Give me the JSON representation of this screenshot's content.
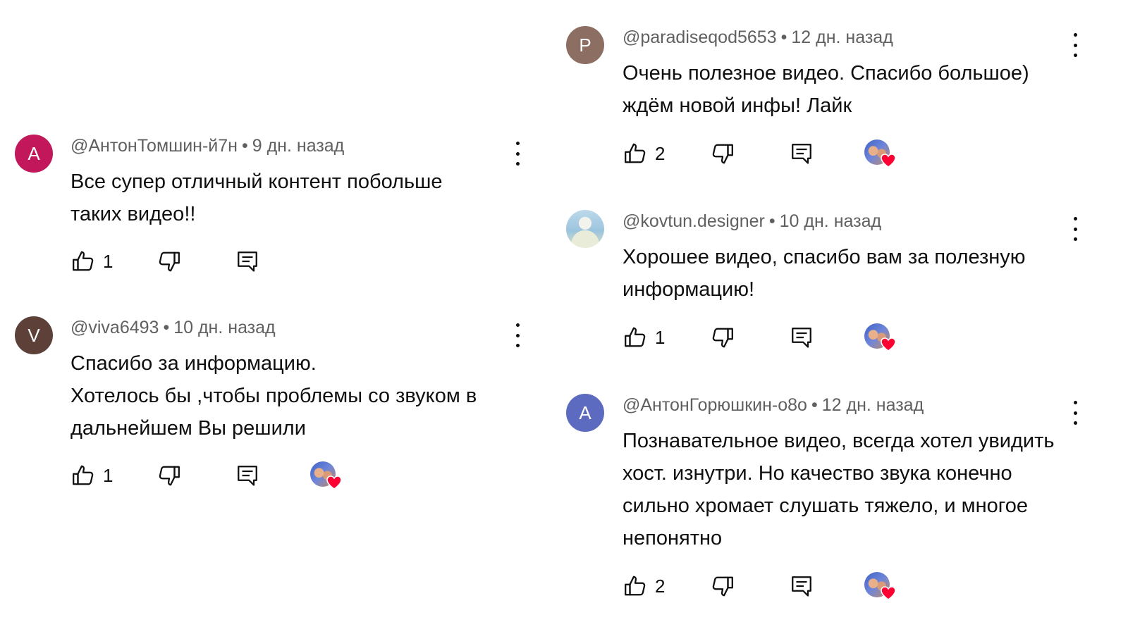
{
  "colors": {
    "avatar_A1": "#c2185b",
    "avatar_V": "#5d4037",
    "avatar_P": "#8d6e63",
    "avatar_A2": "#5c6bc0",
    "heart": "#ff0033"
  },
  "comments": [
    {
      "author": "@АнтонТомшин-й7н",
      "time": "9 дн. назад",
      "avatar_letter": "A",
      "text": "Все супер отличный контент побольше таких видео!!",
      "likes": "1",
      "creator_heart": false
    },
    {
      "author": "@viva6493",
      "time": "10 дн. назад",
      "avatar_letter": "V",
      "text_lines": [
        "Спасибо за информацию.",
        "Хотелось бы ,чтобы проблемы со звуком в дальнейшем Вы решили"
      ],
      "likes": "1",
      "creator_heart": true
    },
    {
      "author": "@paradiseqod5653",
      "time": "12 дн. назад",
      "avatar_letter": "P",
      "text": "Очень полезное видео. Спасибо большое) ждём новой инфы! Лайк",
      "likes": "2",
      "creator_heart": true
    },
    {
      "author": "@kovtun.designer",
      "time": "10 дн. назад",
      "avatar_letter": "",
      "text": "Хорошее видео, спасибо вам за полезную информацию!",
      "likes": "1",
      "creator_heart": true
    },
    {
      "author": "@АнтонГорюшкин-о8о",
      "time": "12 дн. назад",
      "avatar_letter": "A",
      "text": "Познавательное видео, всегда хотел увидить хост. изнутри. Но качество звука конечно сильно хромает слушать тяжело, и многое непонятно",
      "likes": "2",
      "creator_heart": true
    }
  ],
  "separator": "•",
  "icons": {
    "like": "thumbs-up-icon",
    "dislike": "thumbs-down-icon",
    "reply": "comment-reply-icon",
    "more": "more-vert-icon",
    "creator_heart": "creator-heart-icon"
  }
}
